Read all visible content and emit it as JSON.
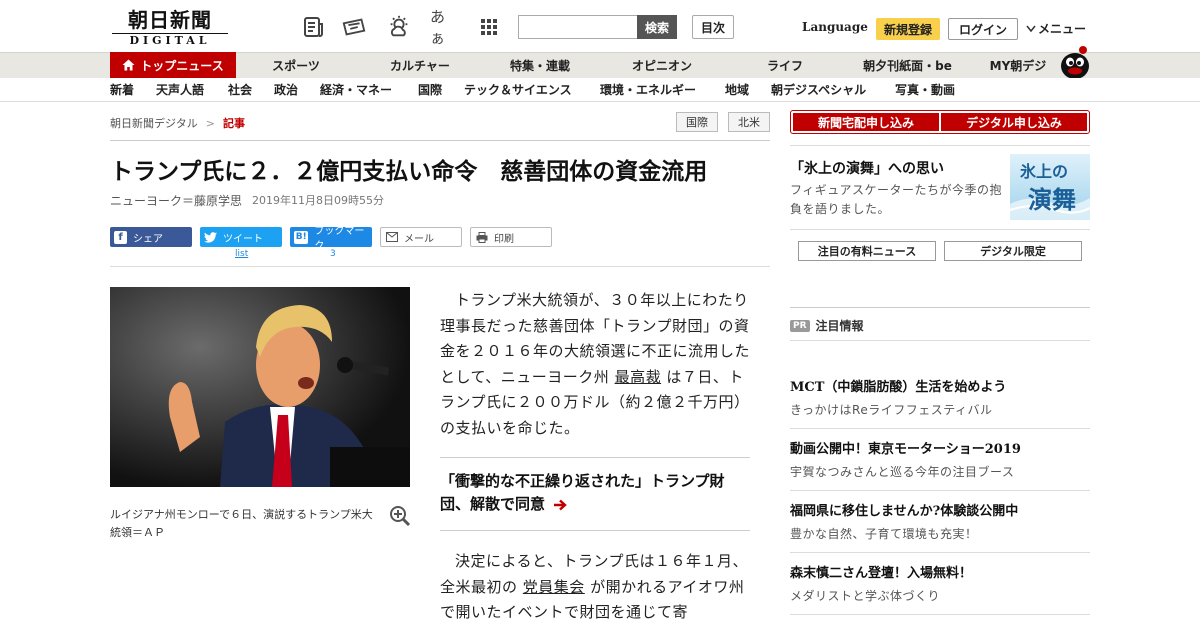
{
  "header": {
    "logo_jp": "朝日新聞",
    "logo_en": "DIGITAL",
    "search_button": "検索",
    "toc_button": "目次",
    "language": "Language",
    "register": "新規登録",
    "login": "ログイン",
    "menu": "メニュー",
    "icons": [
      "newspaper-icon",
      "delivery-icon",
      "weather-icon",
      "font-size-icon",
      "grid-icon"
    ],
    "font_size_glyph": "あぁ"
  },
  "nav_primary": [
    {
      "label": "トップニュース",
      "active": true
    },
    {
      "label": "スポーツ"
    },
    {
      "label": "カルチャー"
    },
    {
      "label": "特集・連載"
    },
    {
      "label": "オピニオン"
    },
    {
      "label": "ライフ"
    },
    {
      "label": "朝夕刊紙面・be"
    },
    {
      "label": "MY朝デジ"
    }
  ],
  "nav_secondary": [
    {
      "label": "新着"
    },
    {
      "label": "天声人語"
    },
    {
      "label": "社会"
    },
    {
      "label": "政治"
    },
    {
      "label": "経済・マネー"
    },
    {
      "label": "国際"
    },
    {
      "label": "テック＆サイエンス"
    },
    {
      "label": "環境・エネルギー"
    },
    {
      "label": "地域"
    },
    {
      "label": "朝デジスペシャル"
    },
    {
      "label": "写真・動画"
    }
  ],
  "breadcrumb": {
    "home": "朝日新聞デジタル",
    "sep": ">",
    "current": "記事",
    "tags": [
      "国際",
      "北米"
    ]
  },
  "article": {
    "headline": "トランプ氏に２．２億円支払い命令　慈善団体の資金流用",
    "author": "ニューヨーク＝藤原学思",
    "date": "2019年11月8日09時55分",
    "share": {
      "facebook": "シェア",
      "twitter": "ツイート",
      "hatena": "ブックマーク",
      "hatena_glyph": "B!",
      "mail": "メール",
      "print": "印刷",
      "twitter_count": "list",
      "hatena_count": "3"
    },
    "caption": "ルイジアナ州モンローで６日、演説するトランプ米大統領＝ＡＰ",
    "para1_a": "トランプ米大統領が、３０年以上にわたり理事長だった慈善団体「トランプ財団」の資金を２０１６年の大統領選に不正に流用したとして、ニューヨーク州 ",
    "para1_link": "最高裁",
    "para1_b": " は７日、トランプ氏に２００万ドル（約２億２千万円）の支払いを命じた。",
    "related_title": "「衝撃的な不正繰り返された」トランプ財団、解散で同意",
    "para2_a": "決定によると、トランプ氏は１６年１月、全米最初の ",
    "para2_link": "党員集会",
    "para2_b": " が開かれるアイオワ州で開いたイベントで財団を通じて寄"
  },
  "sidebar": {
    "subscribe_paper": "新聞宅配申し込み",
    "subscribe_digital": "デジタル申し込み",
    "feature_title": "「氷上の演舞」への思い",
    "feature_desc": "フィギュアスケーターたちが今季の抱負を語りました。",
    "feature_img_line1": "氷上の",
    "feature_img_line2": "演舞",
    "tab_paid": "注目の有料ニュース",
    "tab_digital": "デジタル限定",
    "pr_badge": "PR",
    "pr_heading": "注目情報",
    "pr_items": [
      {
        "title": "MCT（中鎖脂肪酸）生活を始めよう",
        "sub": "きっかけはReライフフェスティバル"
      },
      {
        "title": "動画公開中！東京モーターショー2019",
        "sub": "宇賀なつみさんと巡る今年の注目ブース"
      },
      {
        "title": "福岡県に移住しませんか?体験談公開中",
        "sub": "豊かな自然、子育て環境も充実！"
      },
      {
        "title": "森末慎二さん登壇！入場無料！",
        "sub": "メダリストと学ぶ体づくり"
      }
    ]
  },
  "colors": {
    "brand_red": "#c00000",
    "nav_bg": "#e8e7e2",
    "register_yellow": "#f8d04c"
  }
}
